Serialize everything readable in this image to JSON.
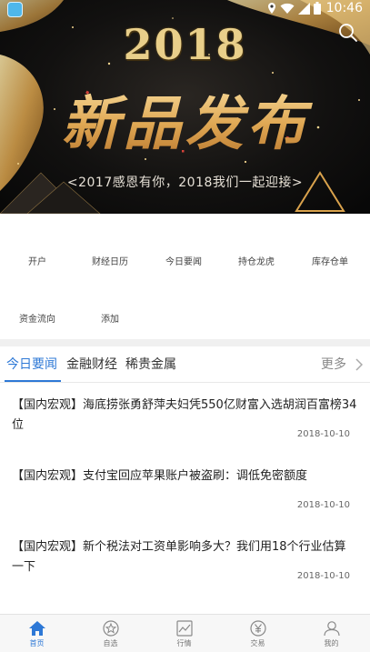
{
  "status_bar": {
    "time": "10:46"
  },
  "banner": {
    "year": "2018",
    "headline": "新品发布",
    "slogan": "<2017感恩有你，2018我们一起迎接>"
  },
  "quick_entries": [
    {
      "label": "开户"
    },
    {
      "label": "财经日历"
    },
    {
      "label": "今日要闻"
    },
    {
      "label": "持仓龙虎"
    },
    {
      "label": "库存仓单"
    },
    {
      "label": "资金流向"
    },
    {
      "label": "添加"
    }
  ],
  "tabs": [
    {
      "label": "今日要闻",
      "active": true
    },
    {
      "label": "金融财经",
      "active": false
    },
    {
      "label": "稀贵金属",
      "active": false
    }
  ],
  "more_label": "更多",
  "news": [
    {
      "title": "【国内宏观】海底捞张勇舒萍夫妇凭550亿财富入选胡润百富榜34位",
      "date": "2018-10-10"
    },
    {
      "title": "【国内宏观】支付宝回应苹果账户被盗刷：调低免密额度",
      "date": "2018-10-10"
    },
    {
      "title": "【国内宏观】新个税法对工资单影响多大？我们用18个行业估算一下",
      "date": "2018-10-10"
    }
  ],
  "bottom_nav": [
    {
      "label": "首页",
      "icon": "home-icon",
      "active": true
    },
    {
      "label": "自选",
      "icon": "star-icon",
      "active": false
    },
    {
      "label": "行情",
      "icon": "chart-icon",
      "active": false
    },
    {
      "label": "交易",
      "icon": "yen-icon",
      "active": false
    },
    {
      "label": "我的",
      "icon": "user-icon",
      "active": false
    }
  ],
  "colors": {
    "accent": "#2d78d6",
    "banner_gold": "#e9cf8a"
  }
}
